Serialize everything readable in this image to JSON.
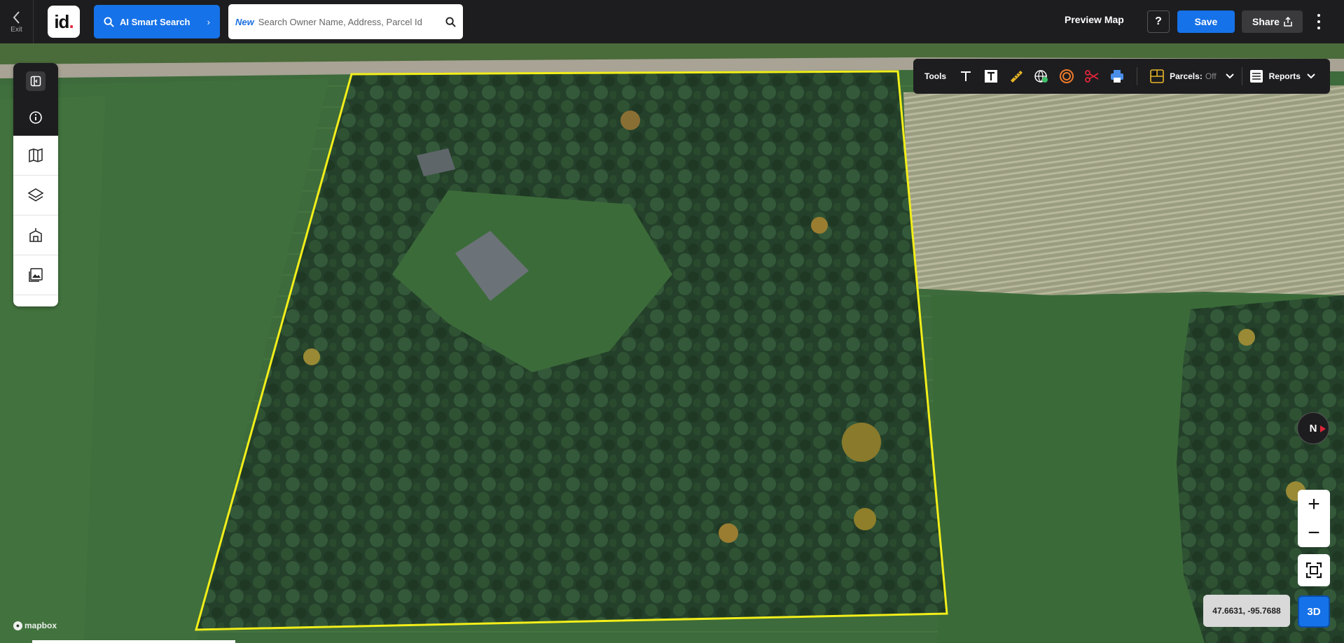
{
  "topbar": {
    "exit_label": "Exit",
    "logo_text": "id",
    "ai_search_label": "AI Smart Search",
    "search_new_tag": "New",
    "search_placeholder": "Search Owner Name, Address, Parcel Id",
    "preview_map_label": "Preview Map",
    "help_label": "?",
    "save_label": "Save",
    "share_label": "Share"
  },
  "sidebar": {
    "items": [
      {
        "icon": "collapse-panel-icon"
      },
      {
        "icon": "info-icon"
      },
      {
        "icon": "map-icon"
      },
      {
        "icon": "layers-icon"
      },
      {
        "icon": "buildings-icon"
      },
      {
        "icon": "image-gallery-icon"
      }
    ]
  },
  "tools": {
    "label": "Tools",
    "items": [
      "text-icon",
      "text-box-icon",
      "ruler-icon",
      "globe-pin-icon",
      "buffer-ring-icon",
      "scissors-icon",
      "print-icon"
    ],
    "parcels_label": "Parcels:",
    "parcels_state": "Off",
    "reports_label": "Reports"
  },
  "map": {
    "compass_label": "N",
    "zoom_in": "+",
    "zoom_out": "−",
    "coordinates": "47.6631, -95.7688",
    "mode_3d_label": "3D",
    "attribution": "mapbox",
    "parcel_outline_color": "#f2ee1a",
    "accent": "#1672e8"
  }
}
